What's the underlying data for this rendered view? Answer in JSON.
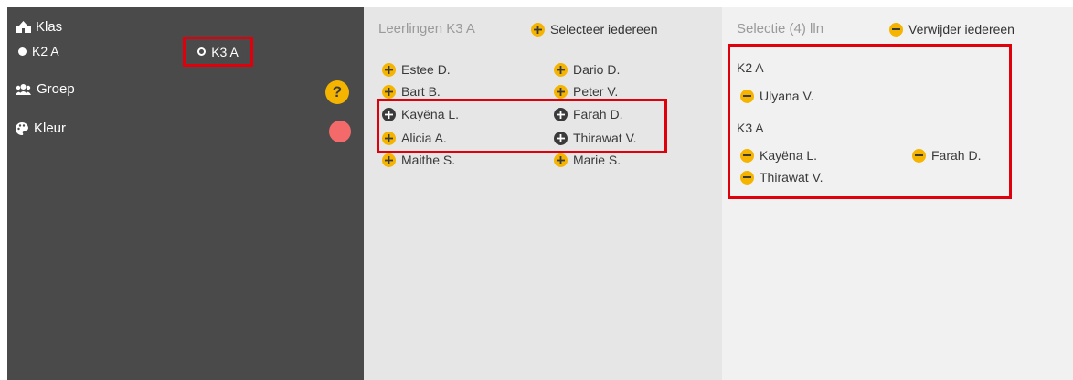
{
  "left": {
    "klas_label": "Klas",
    "classes": [
      {
        "label": "K2 A",
        "selected": true
      },
      {
        "label": "K3 A",
        "selected": false
      }
    ],
    "groep_label": "Groep",
    "help_symbol": "?",
    "kleur_label": "Kleur",
    "kleur_color": "#f46a6a"
  },
  "students": {
    "header": "Leerlingen K3 A",
    "select_all": "Selecteer iedereen",
    "col1": [
      "Estee D.",
      "Bart B.",
      "Kayëna L.",
      "Alicia A.",
      "Maithe S."
    ],
    "col2": [
      "Dario D.",
      "Peter V.",
      "Farah D.",
      "Thirawat V.",
      "Marie S."
    ]
  },
  "selection": {
    "header": "Selectie (4) lln",
    "remove_all": "Verwijder iedereen",
    "groups": [
      {
        "label": "K2 A",
        "col1": [
          "Ulyana V."
        ],
        "col2": []
      },
      {
        "label": "K3 A",
        "col1": [
          "Kayëna L.",
          "Thirawat V."
        ],
        "col2": [
          "Farah D."
        ]
      }
    ]
  },
  "colors": {
    "accent": "#f5b400",
    "highlight": "#e0000b",
    "left_bg": "#4a4a4a"
  }
}
